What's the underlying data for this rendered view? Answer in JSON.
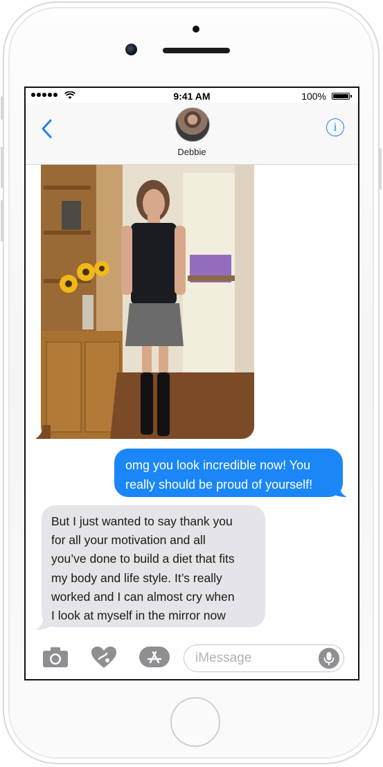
{
  "status_bar": {
    "time": "9:41 AM",
    "battery_percent": "100%"
  },
  "nav": {
    "contact_name": "Debbie",
    "back_icon": "chevron-left-icon",
    "info_icon": "info-circle-icon",
    "info_label": "i"
  },
  "messages": [
    {
      "type": "photo",
      "direction": "received",
      "description_icon": "photo-attachment"
    },
    {
      "type": "text",
      "direction": "sent",
      "lines": [
        "omg you look incredible now! You",
        "really should be proud of yourself!"
      ]
    },
    {
      "type": "text",
      "direction": "received",
      "lines": [
        "But I just wanted to say thank you",
        "for all your motivation and all",
        "you’ve done to build a diet that fits",
        "my body and life style. It’s really",
        "worked and I can almost cry when",
        "I look at myself in the mirror now"
      ]
    }
  ],
  "input": {
    "placeholder": "iMessage",
    "camera_icon": "camera-icon",
    "digital_touch_icon": "digital-touch-heart-icon",
    "app_store_icon": "app-store-icon",
    "mic_icon": "microphone-icon"
  },
  "colors": {
    "accent": "#1a86f8",
    "received_bubble": "#e4e4e9",
    "icon_gray": "#8e8e93"
  }
}
